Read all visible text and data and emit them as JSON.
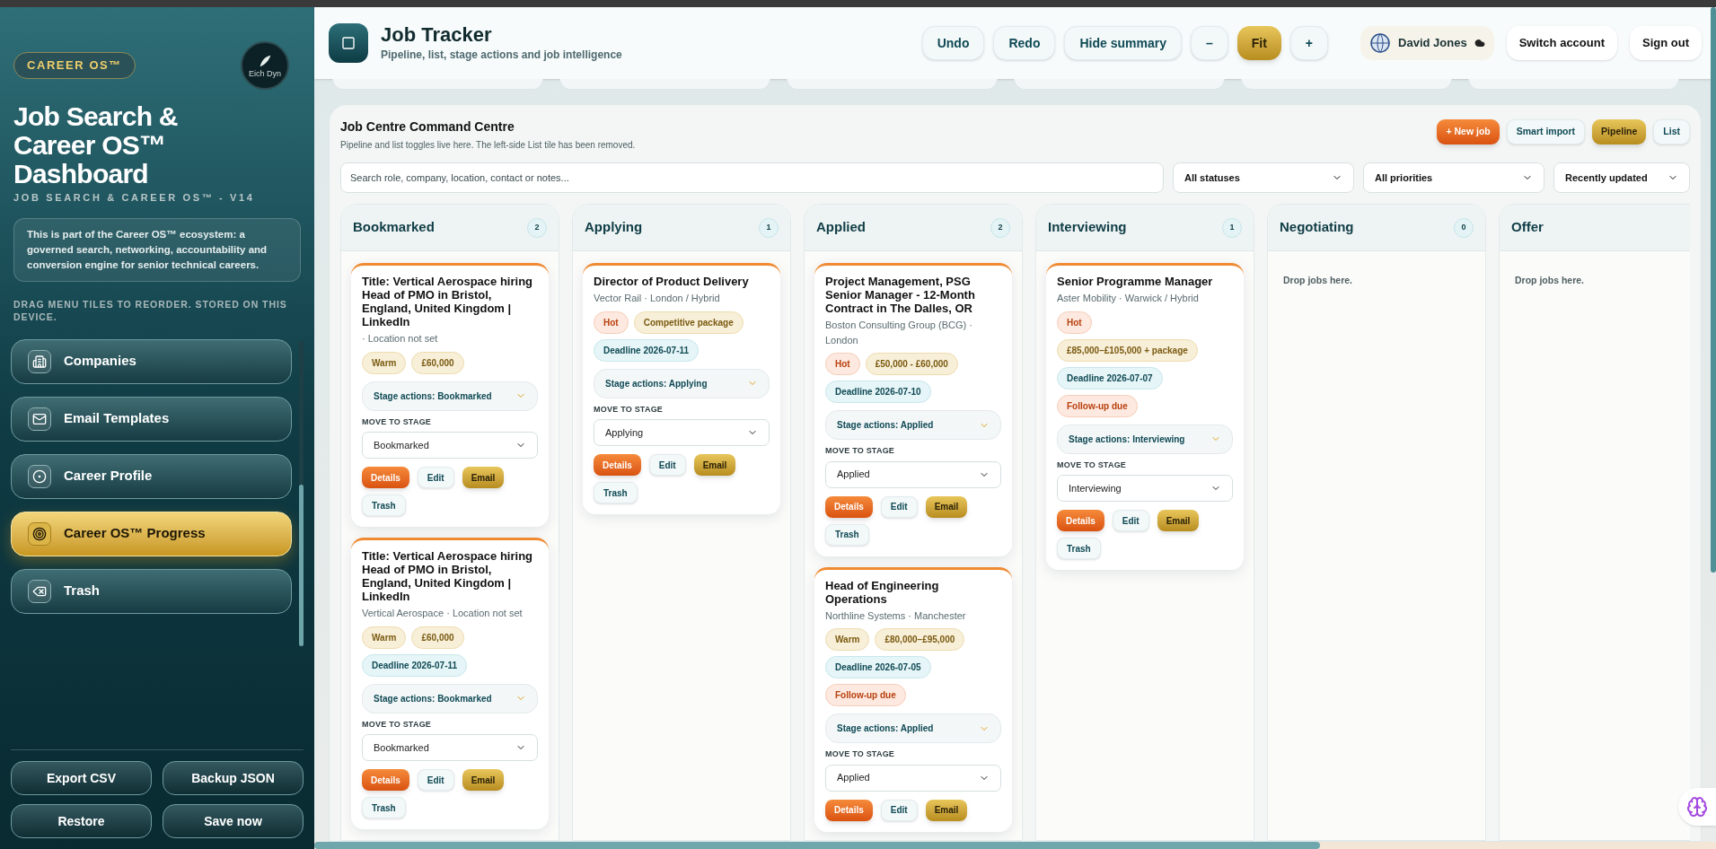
{
  "sidebar": {
    "badge": "CAREER OS™",
    "logo_caption": "Eich Dyn",
    "title": "Job Search & Career OS™ Dashboard",
    "subtitle": "JOB SEARCH & CAREER OS™ - V14",
    "description": "This is part of the Career OS™ ecosystem: a governed search, networking, accountability and conversion engine for senior technical careers.",
    "hint": "DRAG MENU TILES TO REORDER. STORED ON THIS DEVICE.",
    "nav": [
      {
        "label": "Companies",
        "kind": "building",
        "selected": false
      },
      {
        "label": "Email Templates",
        "kind": "mail",
        "selected": false
      },
      {
        "label": "Career Profile",
        "kind": "profile",
        "selected": false
      },
      {
        "label": "Career OS™ Progress",
        "kind": "target",
        "selected": true
      },
      {
        "label": "Trash",
        "kind": "delete",
        "selected": false
      }
    ],
    "actions": [
      "Export CSV",
      "Backup JSON",
      "Restore",
      "Save now"
    ]
  },
  "header": {
    "title": "Job Tracker",
    "subtitle": "Pipeline, list, stage actions and job intelligence",
    "buttons": [
      {
        "label": "Undo",
        "kind": "plain"
      },
      {
        "label": "Redo",
        "kind": "plain"
      },
      {
        "label": "Hide summary",
        "kind": "plain"
      },
      {
        "label": "–",
        "kind": "plain"
      },
      {
        "label": "Fit",
        "kind": "gold"
      },
      {
        "label": "+",
        "kind": "plain"
      }
    ],
    "user": {
      "name": "David Jones"
    },
    "account_buttons": [
      "Switch account",
      "Sign out"
    ]
  },
  "board": {
    "title": "Job Centre Command Centre",
    "note": "Pipeline and list toggles live here. The left-side List tile has been removed.",
    "actions": [
      {
        "label": "+ New job",
        "kind": "primary"
      },
      {
        "label": "Smart import",
        "kind": "plain"
      }
    ],
    "views": [
      {
        "label": "Pipeline",
        "selected": true
      },
      {
        "label": "List",
        "selected": false
      }
    ],
    "search": {
      "placeholder": "Search role, company, location, contact or notes..."
    },
    "filters": [
      "All statuses",
      "All priorities",
      "Recently updated"
    ],
    "columns": [
      {
        "name": "Bookmarked",
        "count": "2",
        "cards": [
          {
            "title": "Title: Vertical Aerospace hiring Head of PMO in Bristol, England, United Kingdom | LinkedIn",
            "meta": "· Location not set",
            "tags": [
              {
                "label": "Warm",
                "kind": "warm"
              },
              {
                "label": "£60,000",
                "kind": "salary"
              }
            ],
            "stage_actions": "Stage actions: Bookmarked",
            "move_label": "MOVE TO STAGE",
            "stage": "Bookmarked",
            "buttons": [
              {
                "label": "Details",
                "kind": "primary"
              },
              {
                "label": "Edit",
                "kind": "plain"
              },
              {
                "label": "Email",
                "kind": "gold"
              },
              {
                "label": "Trash",
                "kind": "plain"
              }
            ]
          },
          {
            "title": "Title: Vertical Aerospace hiring Head of PMO in Bristol, England, United Kingdom | LinkedIn",
            "meta": "Vertical Aerospace · Location not set",
            "tags": [
              {
                "label": "Warm",
                "kind": "warm"
              },
              {
                "label": "£60,000",
                "kind": "salary"
              },
              {
                "label": "Deadline 2026-07-11",
                "kind": "deadline"
              }
            ],
            "stage_actions": "Stage actions: Bookmarked",
            "move_label": "MOVE TO STAGE",
            "stage": "Bookmarked",
            "buttons": [
              {
                "label": "Details",
                "kind": "primary"
              },
              {
                "label": "Edit",
                "kind": "plain"
              },
              {
                "label": "Email",
                "kind": "gold"
              },
              {
                "label": "Trash",
                "kind": "plain"
              }
            ]
          }
        ]
      },
      {
        "name": "Applying",
        "count": "1",
        "cards": [
          {
            "title": "Director of Product Delivery",
            "meta": "Vector Rail · London / Hybrid",
            "tags": [
              {
                "label": "Hot",
                "kind": "hot"
              },
              {
                "label": "Competitive package",
                "kind": "salary"
              },
              {
                "label": "Deadline 2026-07-11",
                "kind": "deadline"
              }
            ],
            "stage_actions": "Stage actions: Applying",
            "move_label": "MOVE TO STAGE",
            "stage": "Applying",
            "buttons": [
              {
                "label": "Details",
                "kind": "primary"
              },
              {
                "label": "Edit",
                "kind": "plain"
              },
              {
                "label": "Email",
                "kind": "gold"
              },
              {
                "label": "Trash",
                "kind": "plain"
              }
            ]
          }
        ]
      },
      {
        "name": "Applied",
        "count": "2",
        "cards": [
          {
            "title": "Project Management, PSG Senior Manager - 12-Month Contract in The Dalles, OR",
            "meta": "Boston Consulting Group (BCG) · London",
            "tags": [
              {
                "label": "Hot",
                "kind": "hot"
              },
              {
                "label": "£50,000 - £60,000",
                "kind": "salary"
              },
              {
                "label": "Deadline 2026-07-10",
                "kind": "deadline"
              }
            ],
            "stage_actions": "Stage actions: Applied",
            "move_label": "MOVE TO STAGE",
            "stage": "Applied",
            "buttons": [
              {
                "label": "Details",
                "kind": "primary"
              },
              {
                "label": "Edit",
                "kind": "plain"
              },
              {
                "label": "Email",
                "kind": "gold"
              },
              {
                "label": "Trash",
                "kind": "plain"
              }
            ]
          },
          {
            "title": "Head of Engineering Operations",
            "meta": "Northline Systems · Manchester",
            "tags": [
              {
                "label": "Warm",
                "kind": "warm"
              },
              {
                "label": "£80,000–£95,000",
                "kind": "salary"
              },
              {
                "label": "Deadline 2026-07-05",
                "kind": "deadline"
              },
              {
                "label": "Follow-up due",
                "kind": "followup"
              }
            ],
            "stage_actions": "Stage actions: Applied",
            "move_label": "MOVE TO STAGE",
            "stage": "Applied",
            "buttons": [
              {
                "label": "Details",
                "kind": "primary"
              },
              {
                "label": "Edit",
                "kind": "plain"
              },
              {
                "label": "Email",
                "kind": "gold"
              }
            ]
          }
        ]
      },
      {
        "name": "Interviewing",
        "count": "1",
        "cards": [
          {
            "title": "Senior Programme Manager",
            "meta": "Aster Mobility · Warwick / Hybrid",
            "tags": [
              {
                "label": "Hot",
                "kind": "hot"
              },
              {
                "label": "£85,000–£105,000 + package",
                "kind": "salary"
              },
              {
                "label": "Deadline 2026-07-07",
                "kind": "deadline"
              },
              {
                "label": "Follow-up due",
                "kind": "followup"
              }
            ],
            "stage_actions": "Stage actions: Interviewing",
            "move_label": "MOVE TO STAGE",
            "stage": "Interviewing",
            "buttons": [
              {
                "label": "Details",
                "kind": "primary"
              },
              {
                "label": "Edit",
                "kind": "plain"
              },
              {
                "label": "Email",
                "kind": "gold"
              },
              {
                "label": "Trash",
                "kind": "plain"
              }
            ]
          }
        ]
      },
      {
        "name": "Negotiating",
        "count": "0",
        "empty_text": "Drop jobs here."
      },
      {
        "name": "Offer",
        "empty_text": "Drop jobs here."
      }
    ]
  }
}
